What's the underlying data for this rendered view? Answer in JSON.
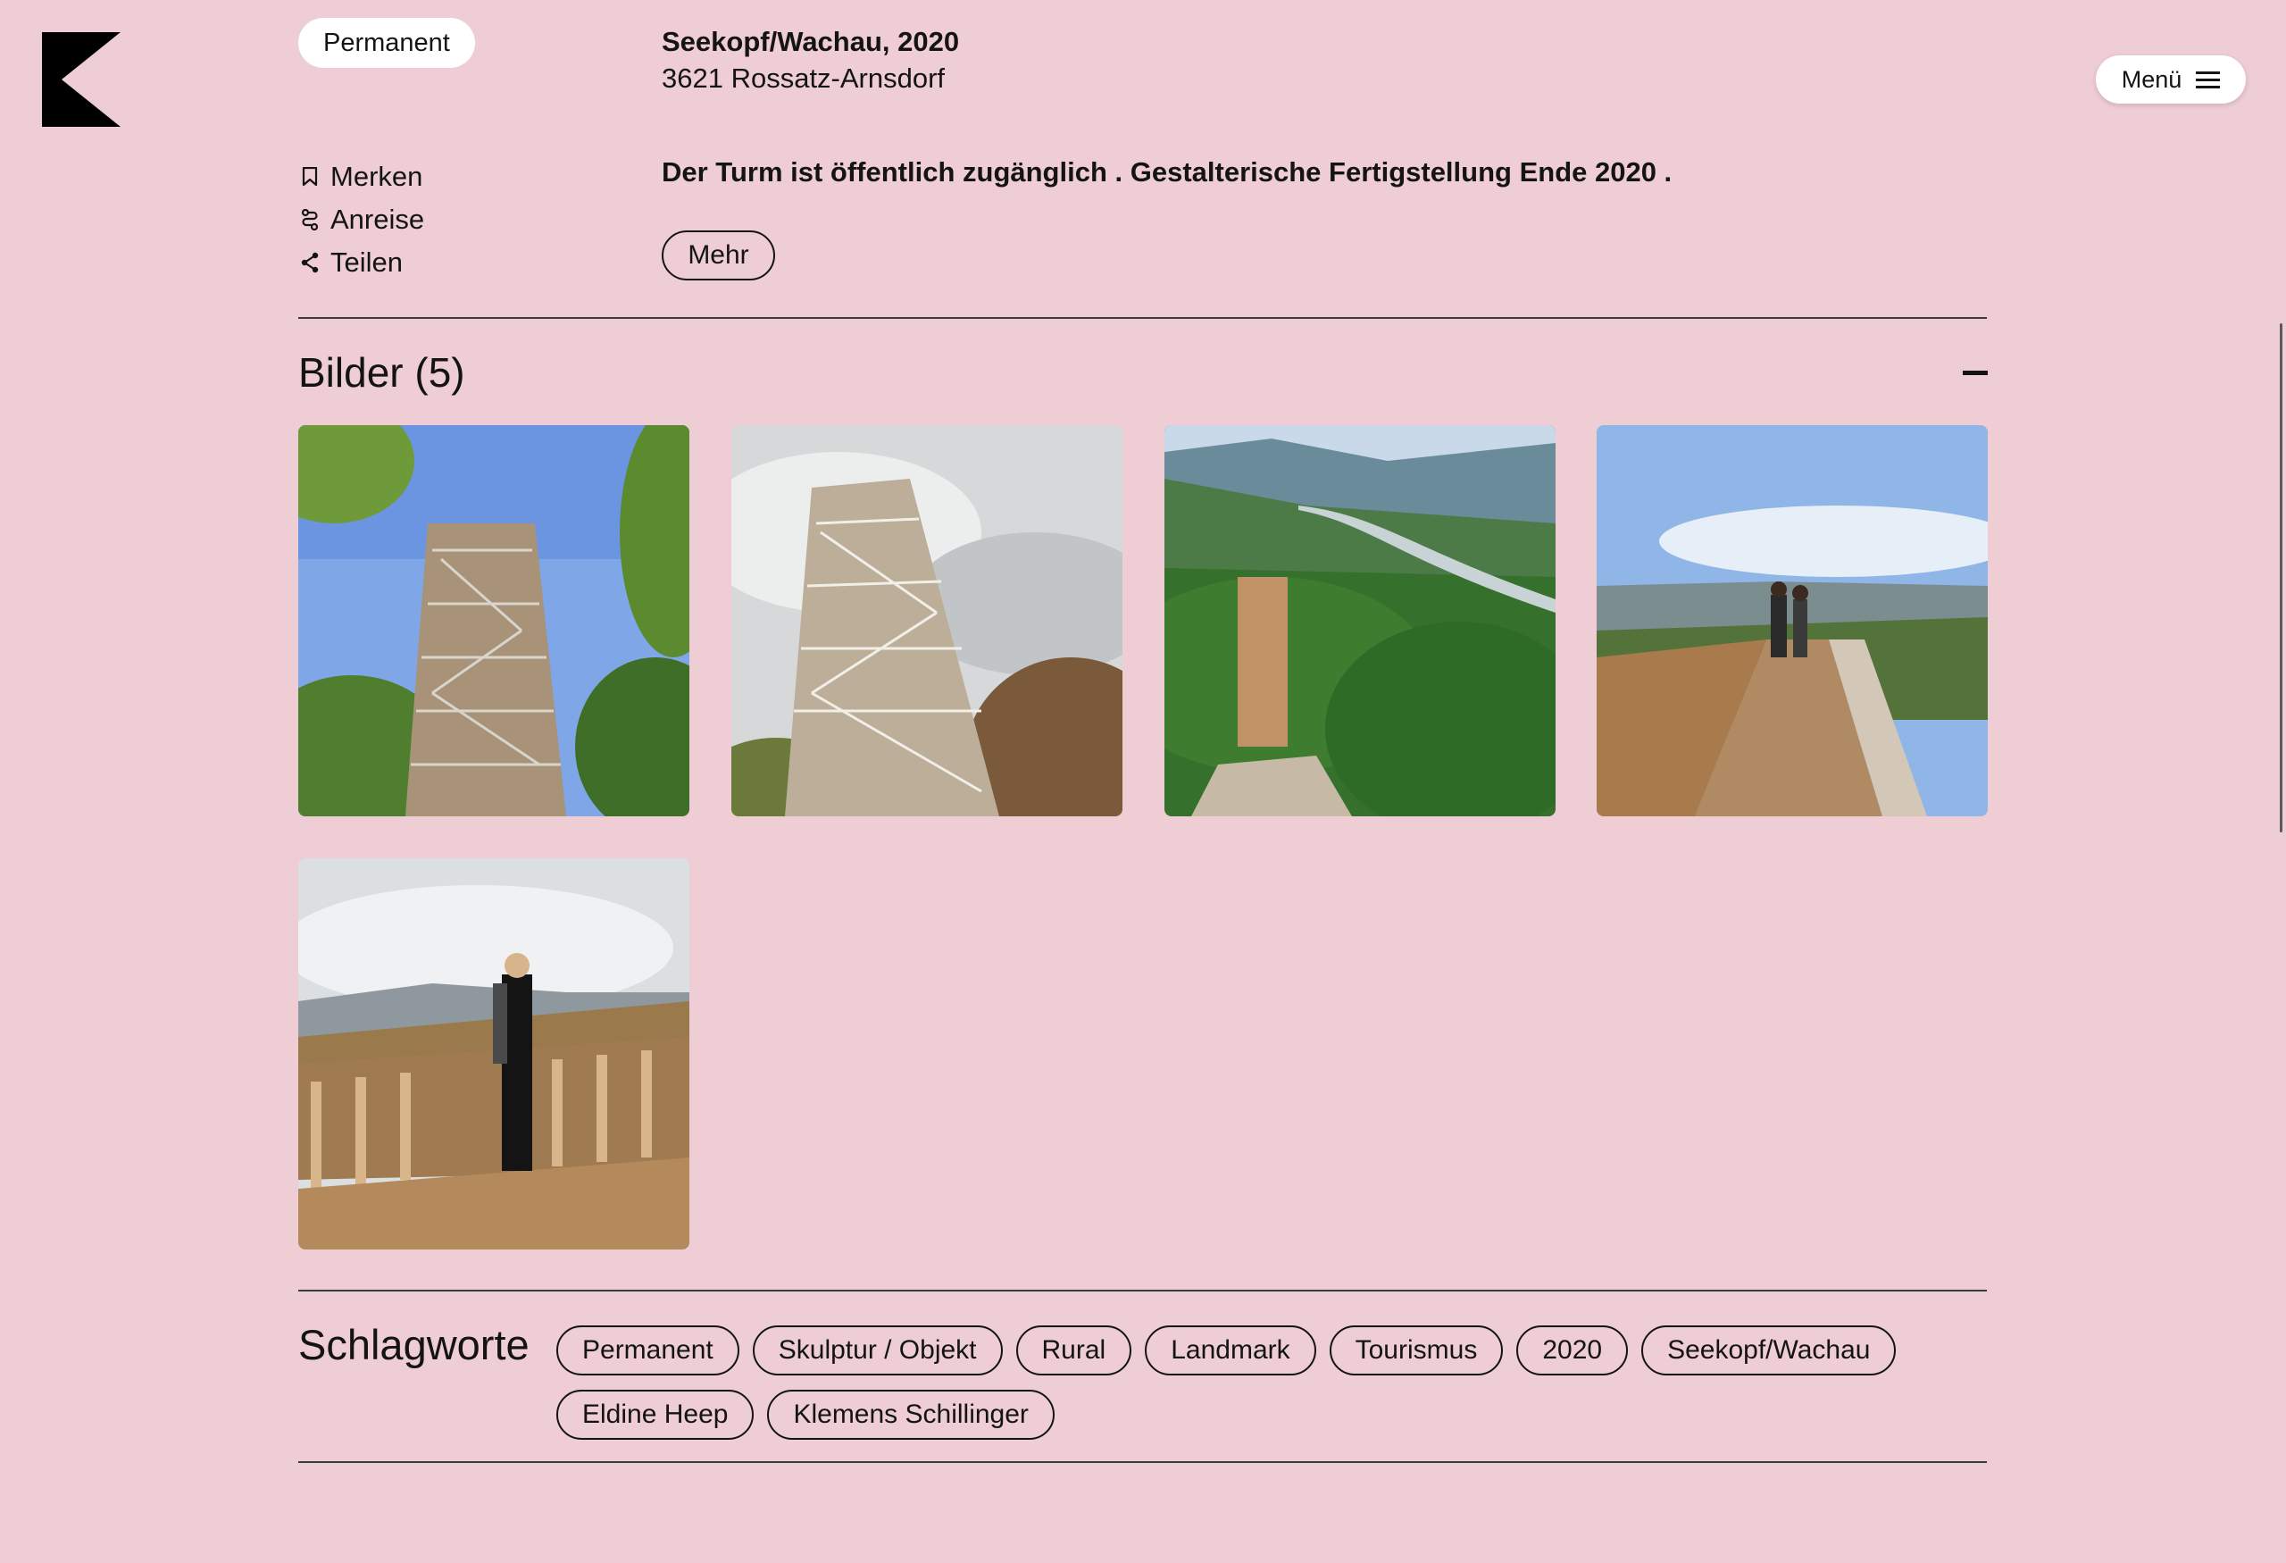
{
  "header": {
    "menu_label": "Menü",
    "status_label": "Permanent",
    "location_title": "Seekopf/Wachau, 2020",
    "location_address": "3621 Rossatz-Arnsdorf"
  },
  "actions": [
    {
      "label": "Merken",
      "icon": "bookmark-icon"
    },
    {
      "label": "Anreise",
      "icon": "route-icon"
    },
    {
      "label": "Teilen",
      "icon": "share-icon"
    }
  ],
  "description": "Der Turm ist öffentlich zugänglich . Gestalterische Fertigstellung Ende 2020 .",
  "more_label": "Mehr",
  "gallery": {
    "title": "Bilder",
    "count": "(5)",
    "images": [
      {
        "name": "tower-from-below-photo"
      },
      {
        "name": "tower-stairs-cloudy-photo"
      },
      {
        "name": "aerial-danube-valley-photo"
      },
      {
        "name": "viewing-platform-couple-photo"
      },
      {
        "name": "woman-on-platform-photo"
      }
    ]
  },
  "tags": {
    "title": "Schlagworte",
    "items": [
      "Permanent",
      "Skulptur / Objekt",
      "Rural",
      "Landmark",
      "Tourismus",
      "2020",
      "Seekopf/Wachau",
      "Eldine Heep",
      "Klemens Schillinger"
    ]
  },
  "colors": {
    "background": "#eecdd4",
    "text": "#141414",
    "pill": "#ffffff"
  }
}
